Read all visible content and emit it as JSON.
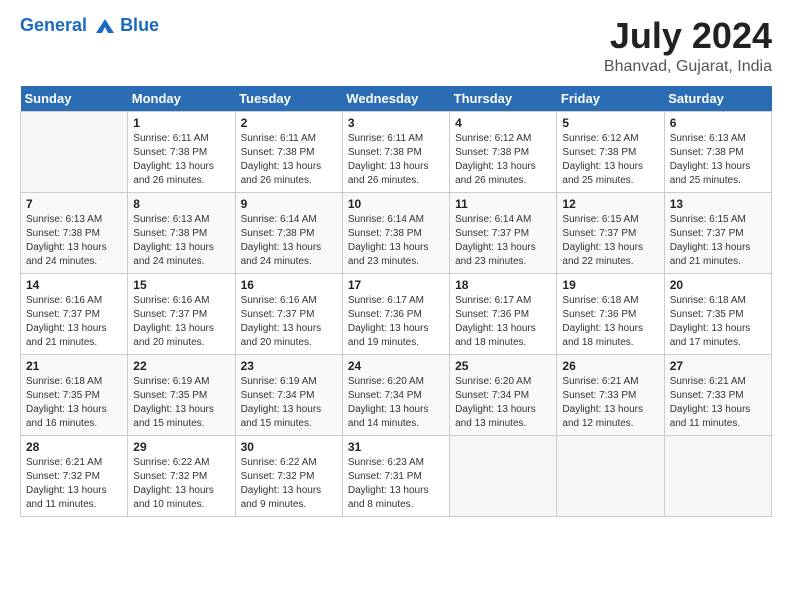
{
  "header": {
    "logo_line1": "General",
    "logo_line2": "Blue",
    "title": "July 2024",
    "subtitle": "Bhanvad, Gujarat, India"
  },
  "days_of_week": [
    "Sunday",
    "Monday",
    "Tuesday",
    "Wednesday",
    "Thursday",
    "Friday",
    "Saturday"
  ],
  "weeks": [
    [
      {
        "day": "",
        "sunrise": "",
        "sunset": "",
        "daylight": ""
      },
      {
        "day": "1",
        "sunrise": "6:11 AM",
        "sunset": "7:38 PM",
        "daylight": "13 hours and 26 minutes."
      },
      {
        "day": "2",
        "sunrise": "6:11 AM",
        "sunset": "7:38 PM",
        "daylight": "13 hours and 26 minutes."
      },
      {
        "day": "3",
        "sunrise": "6:11 AM",
        "sunset": "7:38 PM",
        "daylight": "13 hours and 26 minutes."
      },
      {
        "day": "4",
        "sunrise": "6:12 AM",
        "sunset": "7:38 PM",
        "daylight": "13 hours and 26 minutes."
      },
      {
        "day": "5",
        "sunrise": "6:12 AM",
        "sunset": "7:38 PM",
        "daylight": "13 hours and 25 minutes."
      },
      {
        "day": "6",
        "sunrise": "6:13 AM",
        "sunset": "7:38 PM",
        "daylight": "13 hours and 25 minutes."
      }
    ],
    [
      {
        "day": "7",
        "sunrise": "6:13 AM",
        "sunset": "7:38 PM",
        "daylight": "13 hours and 24 minutes."
      },
      {
        "day": "8",
        "sunrise": "6:13 AM",
        "sunset": "7:38 PM",
        "daylight": "13 hours and 24 minutes."
      },
      {
        "day": "9",
        "sunrise": "6:14 AM",
        "sunset": "7:38 PM",
        "daylight": "13 hours and 24 minutes."
      },
      {
        "day": "10",
        "sunrise": "6:14 AM",
        "sunset": "7:38 PM",
        "daylight": "13 hours and 23 minutes."
      },
      {
        "day": "11",
        "sunrise": "6:14 AM",
        "sunset": "7:37 PM",
        "daylight": "13 hours and 23 minutes."
      },
      {
        "day": "12",
        "sunrise": "6:15 AM",
        "sunset": "7:37 PM",
        "daylight": "13 hours and 22 minutes."
      },
      {
        "day": "13",
        "sunrise": "6:15 AM",
        "sunset": "7:37 PM",
        "daylight": "13 hours and 21 minutes."
      }
    ],
    [
      {
        "day": "14",
        "sunrise": "6:16 AM",
        "sunset": "7:37 PM",
        "daylight": "13 hours and 21 minutes."
      },
      {
        "day": "15",
        "sunrise": "6:16 AM",
        "sunset": "7:37 PM",
        "daylight": "13 hours and 20 minutes."
      },
      {
        "day": "16",
        "sunrise": "6:16 AM",
        "sunset": "7:37 PM",
        "daylight": "13 hours and 20 minutes."
      },
      {
        "day": "17",
        "sunrise": "6:17 AM",
        "sunset": "7:36 PM",
        "daylight": "13 hours and 19 minutes."
      },
      {
        "day": "18",
        "sunrise": "6:17 AM",
        "sunset": "7:36 PM",
        "daylight": "13 hours and 18 minutes."
      },
      {
        "day": "19",
        "sunrise": "6:18 AM",
        "sunset": "7:36 PM",
        "daylight": "13 hours and 18 minutes."
      },
      {
        "day": "20",
        "sunrise": "6:18 AM",
        "sunset": "7:35 PM",
        "daylight": "13 hours and 17 minutes."
      }
    ],
    [
      {
        "day": "21",
        "sunrise": "6:18 AM",
        "sunset": "7:35 PM",
        "daylight": "13 hours and 16 minutes."
      },
      {
        "day": "22",
        "sunrise": "6:19 AM",
        "sunset": "7:35 PM",
        "daylight": "13 hours and 15 minutes."
      },
      {
        "day": "23",
        "sunrise": "6:19 AM",
        "sunset": "7:34 PM",
        "daylight": "13 hours and 15 minutes."
      },
      {
        "day": "24",
        "sunrise": "6:20 AM",
        "sunset": "7:34 PM",
        "daylight": "13 hours and 14 minutes."
      },
      {
        "day": "25",
        "sunrise": "6:20 AM",
        "sunset": "7:34 PM",
        "daylight": "13 hours and 13 minutes."
      },
      {
        "day": "26",
        "sunrise": "6:21 AM",
        "sunset": "7:33 PM",
        "daylight": "13 hours and 12 minutes."
      },
      {
        "day": "27",
        "sunrise": "6:21 AM",
        "sunset": "7:33 PM",
        "daylight": "13 hours and 11 minutes."
      }
    ],
    [
      {
        "day": "28",
        "sunrise": "6:21 AM",
        "sunset": "7:32 PM",
        "daylight": "13 hours and 11 minutes."
      },
      {
        "day": "29",
        "sunrise": "6:22 AM",
        "sunset": "7:32 PM",
        "daylight": "13 hours and 10 minutes."
      },
      {
        "day": "30",
        "sunrise": "6:22 AM",
        "sunset": "7:32 PM",
        "daylight": "13 hours and 9 minutes."
      },
      {
        "day": "31",
        "sunrise": "6:23 AM",
        "sunset": "7:31 PM",
        "daylight": "13 hours and 8 minutes."
      },
      {
        "day": "",
        "sunrise": "",
        "sunset": "",
        "daylight": ""
      },
      {
        "day": "",
        "sunrise": "",
        "sunset": "",
        "daylight": ""
      },
      {
        "day": "",
        "sunrise": "",
        "sunset": "",
        "daylight": ""
      }
    ]
  ]
}
